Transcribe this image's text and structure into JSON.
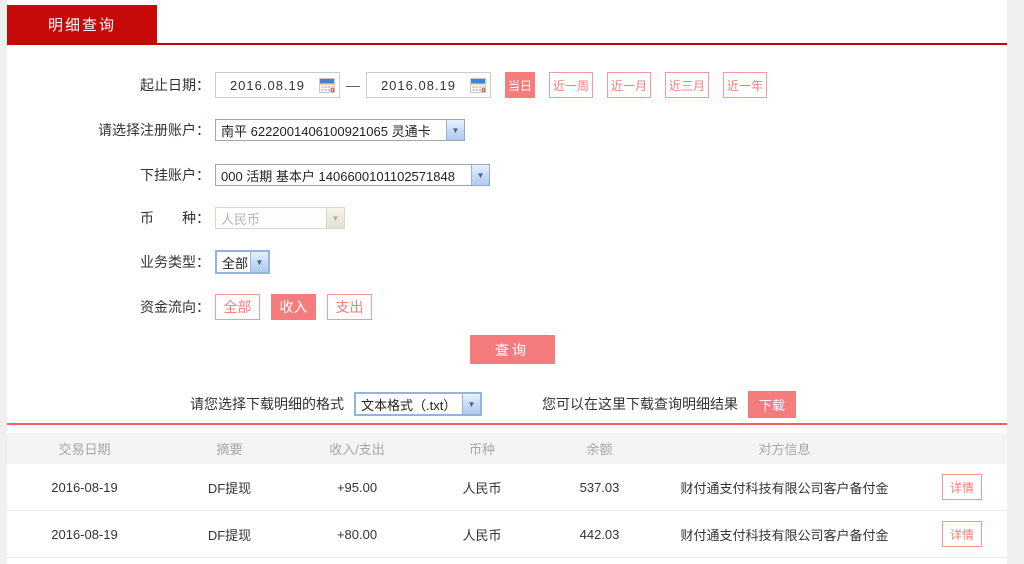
{
  "tab": {
    "label": "明细查询"
  },
  "form": {
    "date_label": "起止日期：",
    "date_from": "2016.08.19",
    "date_separator": "—",
    "date_to": "2016.08.19",
    "quick_ranges": [
      {
        "label": "当日",
        "active": true
      },
      {
        "label": "近一周",
        "active": false
      },
      {
        "label": "近一月",
        "active": false
      },
      {
        "label": "近三月",
        "active": false
      },
      {
        "label": "近一年",
        "active": false
      }
    ],
    "register_account_label": "请选择注册账户：",
    "register_account_value": "南平 6222001406100921065 灵通卡",
    "sub_account_label": "下挂账户：",
    "sub_account_value": "000 活期 基本户 1406600101102571848",
    "currency_label": "币　　种：",
    "currency_value": "人民币",
    "currency_disabled": true,
    "business_type_label": "业务类型：",
    "business_type_value": "全部",
    "flow_label": "资金流向：",
    "flow_options": [
      {
        "label": "全部",
        "active": false
      },
      {
        "label": "收入",
        "active": true
      },
      {
        "label": "支出",
        "active": false
      }
    ],
    "query_button": "查询"
  },
  "download": {
    "format_label": "请您选择下载明细的格式",
    "format_value": "文本格式（.txt）",
    "hint": "您可以在这里下载查询明细结果",
    "button": "下载"
  },
  "table": {
    "headers": [
      "交易日期",
      "摘要",
      "收入/支出",
      "币种",
      "余额",
      "对方信息"
    ],
    "rows": [
      {
        "date": "2016-08-19",
        "summary": "DF提现",
        "amount": "+95.00",
        "currency": "人民币",
        "balance": "537.03",
        "counterparty": "财付通支付科技有限公司客户备付金",
        "action": "详情"
      },
      {
        "date": "2016-08-19",
        "summary": "DF提现",
        "amount": "+80.00",
        "currency": "人民币",
        "balance": "442.03",
        "counterparty": "财付通支付科技有限公司客户备付金",
        "action": "详情"
      }
    ]
  },
  "icons": {
    "calendar": "calendar-icon",
    "dropdown_arrow": "chevron-down-icon"
  },
  "colors": {
    "tab_red": "#c60a0a",
    "tab_underline": "#bd0808",
    "accent_salmon": "#f47c7c",
    "salmon_outline": "#f49a9a",
    "section_divider": "#f55e5e",
    "amount_red": "#d40000",
    "header_text": "#a7a7a7",
    "page_margin": "#f0f0f0"
  }
}
